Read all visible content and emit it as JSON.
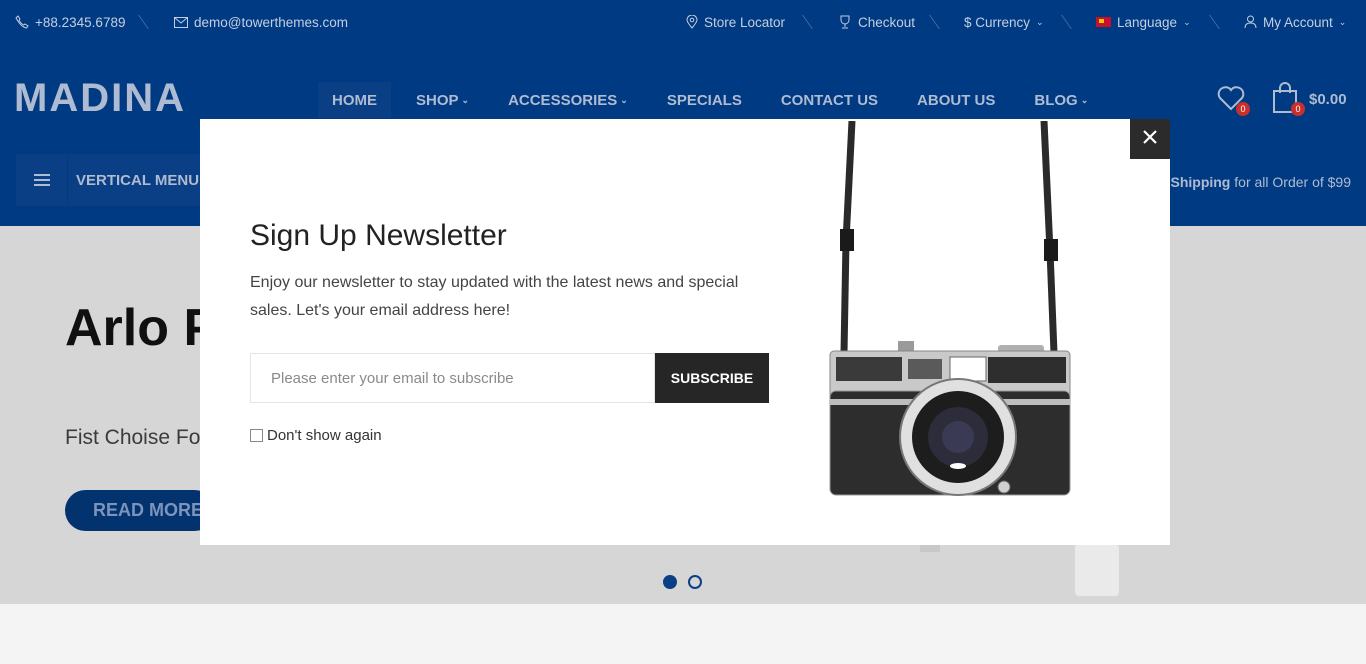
{
  "topbar": {
    "phone": "+88.2345.6789",
    "email": "demo@towerthemes.com",
    "store_locator": "Store Locator",
    "checkout": "Checkout",
    "currency": "$ Currency",
    "language": "Language",
    "account": "My Account"
  },
  "header": {
    "logo": "MADINA",
    "nav": [
      "HOME",
      "SHOP",
      "ACCESSORIES",
      "SPECIALS",
      "CONTACT US",
      "ABOUT US",
      "BLOG"
    ],
    "wishlist_count": "0",
    "cart_count": "0",
    "cart_total": "$0.00",
    "vertical_menu": "VERTICAL MENU",
    "shipping_bold": "Shipping",
    "shipping_rest": " for all Order of $99"
  },
  "hero": {
    "title": "Arlo Pro Wi-Fi",
    "subtitle": "Fist Choise For",
    "button": "READ MORE"
  },
  "modal": {
    "title": "Sign Up Newsletter",
    "text": "Enjoy our newsletter to stay updated with the latest news and special sales. Let's your email address here!",
    "email_placeholder": "Please enter your email to subscribe",
    "subscribe": "SUBSCRIBE",
    "dont_show": "Don't show again"
  },
  "colors": {
    "header_bg": "#003a82",
    "button_dark": "#262626",
    "badge": "#c9302c"
  }
}
